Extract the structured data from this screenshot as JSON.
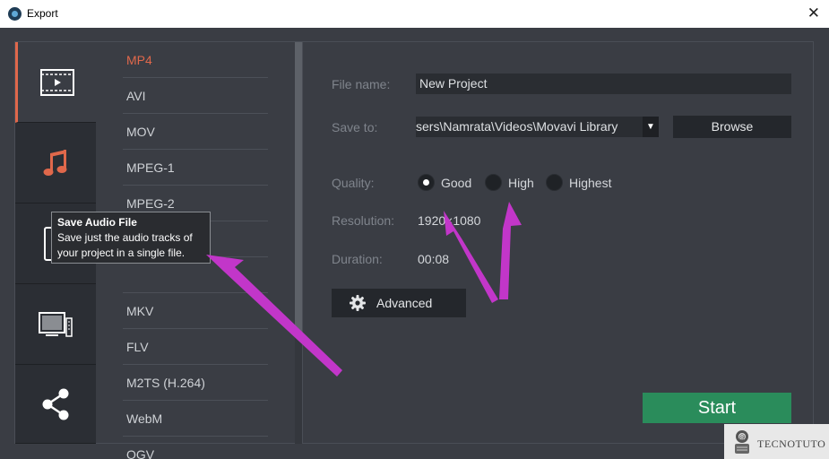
{
  "window": {
    "title": "Export",
    "close_glyph": "✕"
  },
  "categories": [
    {
      "name": "video",
      "icon": "film-icon",
      "active": true
    },
    {
      "name": "audio",
      "icon": "music-note-icon",
      "active": false
    },
    {
      "name": "devices",
      "icon": "tablet-icon",
      "active": false
    },
    {
      "name": "tv",
      "icon": "tv-icon",
      "active": false
    },
    {
      "name": "share",
      "icon": "share-icon",
      "active": false
    }
  ],
  "formats": [
    "MP4",
    "AVI",
    "MOV",
    "MPEG-1",
    "MPEG-2",
    "",
    "",
    "MKV",
    "FLV",
    "M2TS (H.264)",
    "WebM",
    "OGV"
  ],
  "active_format": "MP4",
  "form": {
    "file_name_label": "File name:",
    "file_name_value": "New Project",
    "save_to_label": "Save to:",
    "save_to_value": "sers\\Namrata\\Videos\\Movavi Library",
    "dropdown_glyph": "▼",
    "browse_label": "Browse",
    "quality_label": "Quality:",
    "quality_options": [
      "Good",
      "High",
      "Highest"
    ],
    "quality_selected": "Good",
    "resolution_label": "Resolution:",
    "resolution_value": "1920×1080",
    "duration_label": "Duration:",
    "duration_value": "00:08",
    "advanced_label": "Advanced",
    "start_label": "Start"
  },
  "tooltip": {
    "title": "Save Audio File",
    "line1": "Save just the audio tracks of",
    "line2": "your project in a single file."
  },
  "watermark": {
    "text": "TECNOTUTO"
  },
  "colors": {
    "accent": "#e0684b",
    "start": "#2a8c5b",
    "arrow": "#c236c9",
    "background": "#3a3d44"
  }
}
